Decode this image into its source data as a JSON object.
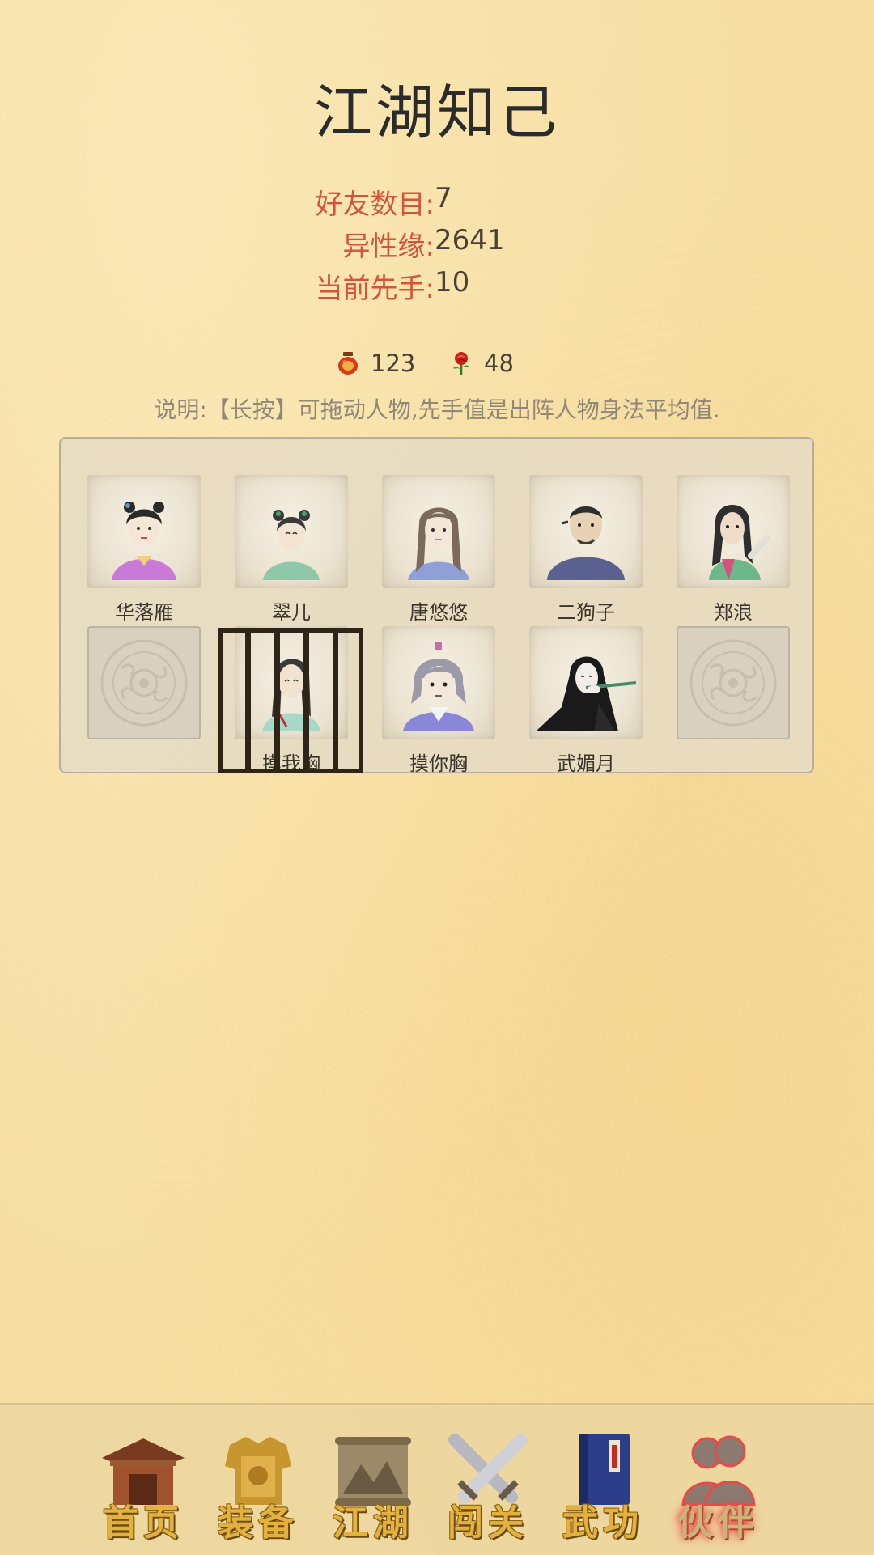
{
  "title": "江湖知己",
  "stats": [
    {
      "label": "好友数目:",
      "value": "7"
    },
    {
      "label": "异性缘:",
      "value": "2641"
    },
    {
      "label": "当前先手:",
      "value": "10"
    }
  ],
  "resources": {
    "wine": {
      "icon": "wine-jar-icon",
      "value": "123"
    },
    "rose": {
      "icon": "rose-icon",
      "value": "48"
    }
  },
  "note": "说明:【长按】可拖动人物,先手值是出阵人物身法平均值.",
  "companions": {
    "row1": [
      "华落雁",
      "翠儿",
      "唐悠悠",
      "二狗子",
      "郑浪"
    ],
    "row2": [
      "",
      "摸我胸",
      "摸你胸",
      "武媚月",
      ""
    ]
  },
  "nav": {
    "items": [
      {
        "label": "首页",
        "icon": "house-icon"
      },
      {
        "label": "装备",
        "icon": "armor-icon"
      },
      {
        "label": "江湖",
        "icon": "scroll-icon"
      },
      {
        "label": "闯关",
        "icon": "crossed-swords-icon"
      },
      {
        "label": "武功",
        "icon": "book-icon"
      },
      {
        "label": "伙伴",
        "icon": "partners-icon"
      }
    ],
    "active": "伙伴"
  }
}
